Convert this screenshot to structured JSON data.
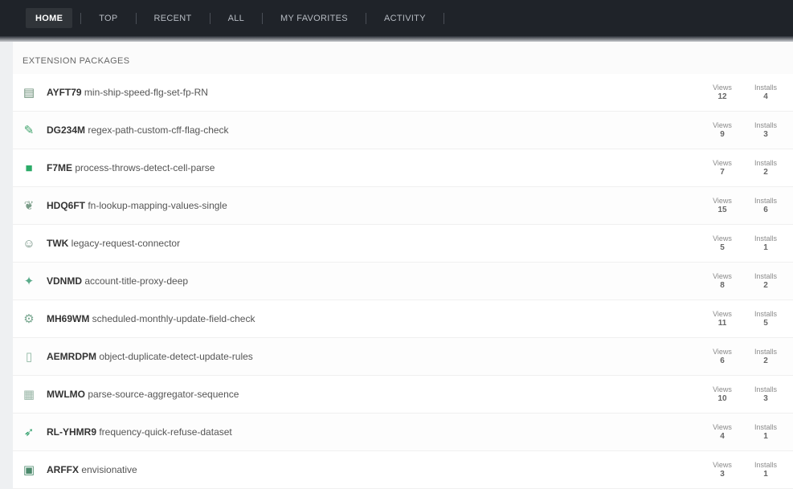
{
  "nav": {
    "items": [
      {
        "label": "HOME",
        "active": true
      },
      {
        "label": "TOP"
      },
      {
        "label": "RECENT"
      },
      {
        "label": "ALL"
      },
      {
        "label": "MY FAVORITES"
      },
      {
        "label": "ACTIVITY"
      }
    ]
  },
  "section": {
    "title": "Extension Packages"
  },
  "rows": [
    {
      "icon": "doc-icon",
      "glyph": "▤",
      "color": "#6b8f78",
      "code": "AYFT79",
      "text": " min-ship-speed-flg-set-fp-RN",
      "s1l": "Views",
      "s1v": "12",
      "s2l": "Installs",
      "s2v": "4"
    },
    {
      "icon": "wand-icon",
      "glyph": "✎",
      "color": "#3fa36b",
      "code": "DG234M",
      "text": " regex-path-custom-cff-flag-check",
      "s1l": "Views",
      "s1v": "9",
      "s2l": "Installs",
      "s2v": "3"
    },
    {
      "icon": "box-icon",
      "glyph": "■",
      "color": "#2cab68",
      "code": "F7ME",
      "text": " process-throws-detect-cell-parse",
      "s1l": "Views",
      "s1v": "7",
      "s2l": "Installs",
      "s2v": "2"
    },
    {
      "icon": "leaf-icon",
      "glyph": "❦",
      "color": "#7a9c88",
      "code": "HDQ6FT",
      "text": " fn-lookup-mapping-values-single",
      "s1l": "Views",
      "s1v": "15",
      "s2l": "Installs",
      "s2v": "6"
    },
    {
      "icon": "user-icon",
      "glyph": "☺",
      "color": "#6a8a7a",
      "code": "TWK",
      "text": " legacy-request-connector",
      "s1l": "Views",
      "s1v": "5",
      "s2l": "Installs",
      "s2v": "1"
    },
    {
      "icon": "star-icon",
      "glyph": "✦",
      "color": "#5aab8a",
      "code": "VDNMD",
      "text": " account-title-proxy-deep",
      "s1l": "Views",
      "s1v": "8",
      "s2l": "Installs",
      "s2v": "2"
    },
    {
      "icon": "gear-icon",
      "glyph": "⚙",
      "color": "#7aa891",
      "code": "MH69WM",
      "text": " scheduled-monthly-update-field-check",
      "s1l": "Views",
      "s1v": "11",
      "s2l": "Installs",
      "s2v": "5"
    },
    {
      "icon": "page-icon",
      "glyph": "▯",
      "color": "#8fb7a2",
      "code": "AEMRDPM",
      "text": " object-duplicate-detect-update-rules",
      "s1l": "Views",
      "s1v": "6",
      "s2l": "Installs",
      "s2v": "2"
    },
    {
      "icon": "grid-icon",
      "glyph": "▦",
      "color": "#9bb7a8",
      "code": "MWLMO",
      "text": " parse-source-aggregator-sequence",
      "s1l": "Views",
      "s1v": "10",
      "s2l": "Installs",
      "s2v": "3"
    },
    {
      "icon": "arrow-icon",
      "glyph": "➶",
      "color": "#2f9f6a",
      "code": "RL-YHMR9",
      "text": " frequency-quick-refuse-dataset",
      "s1l": "Views",
      "s1v": "4",
      "s2l": "Installs",
      "s2v": "1"
    },
    {
      "icon": "stack-icon",
      "glyph": "▣",
      "color": "#4c8a6c",
      "code": "ARFFX",
      "text": " envisionative",
      "s1l": "Views",
      "s1v": "3",
      "s2l": "Installs",
      "s2v": "1"
    }
  ]
}
